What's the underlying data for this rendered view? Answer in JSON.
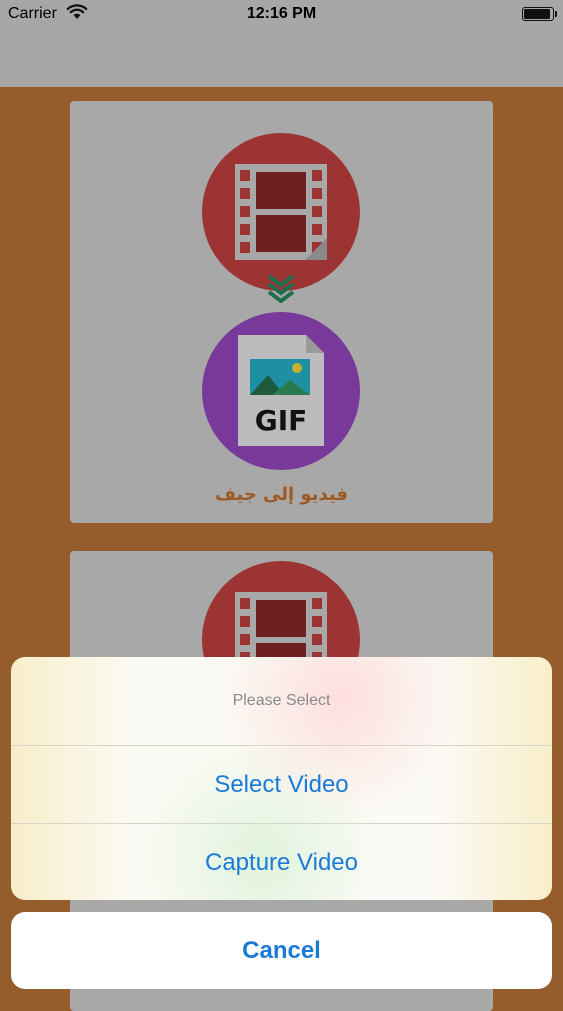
{
  "status_bar": {
    "carrier": "Carrier",
    "time": "12:16 PM",
    "icons": [
      "wifi-icon",
      "battery-icon"
    ]
  },
  "cards": [
    {
      "label": "فيديو إلى جيف",
      "top_icon": "video-film-icon",
      "arrow_icon": "double-chevron-down-icon",
      "bottom_icon": "gif-file-icon",
      "gif_text": "GIF"
    },
    {
      "top_icon": "video-film-icon"
    }
  ],
  "action_sheet": {
    "title": "Please Select",
    "options": [
      "Select Video",
      "Capture Video"
    ],
    "cancel": "Cancel"
  },
  "colors": {
    "background": "#955c2c",
    "card": "#a8a8a8",
    "red_circle": "#9c3434",
    "purple_circle": "#78399a",
    "arrow_green": "#1e6e4e",
    "action_blue": "#1a7ad8"
  }
}
